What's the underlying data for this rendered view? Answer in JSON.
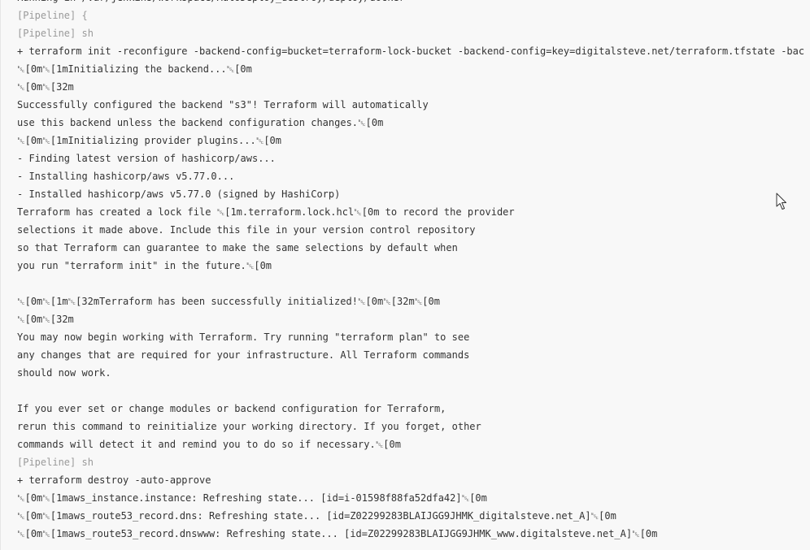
{
  "console": {
    "lines": [
      {
        "text": "Running in /var/jenkins/workspace/AutoDeploy_destroy/deploy/docker",
        "kind": "normal"
      },
      {
        "text": "[Pipeline] {",
        "kind": "pipeline"
      },
      {
        "text": "[Pipeline] sh",
        "kind": "pipeline"
      },
      {
        "text": "+ terraform init -reconfigure -backend-config=bucket=terraform-lock-bucket -backend-config=key=digitalsteve.net/terraform.tfstate -bac",
        "kind": "normal"
      },
      {
        "text": "\u001b[0m\u001b[1mInitializing the backend...\u001b[0m",
        "kind": "normal"
      },
      {
        "text": "\u001b[0m\u001b[32m",
        "kind": "normal"
      },
      {
        "text": "Successfully configured the backend \"s3\"! Terraform will automatically",
        "kind": "normal"
      },
      {
        "text": "use this backend unless the backend configuration changes.\u001b[0m",
        "kind": "normal"
      },
      {
        "text": "\u001b[0m\u001b[1mInitializing provider plugins...\u001b[0m",
        "kind": "normal"
      },
      {
        "text": "- Finding latest version of hashicorp/aws...",
        "kind": "normal"
      },
      {
        "text": "- Installing hashicorp/aws v5.77.0...",
        "kind": "normal"
      },
      {
        "text": "- Installed hashicorp/aws v5.77.0 (signed by HashiCorp)",
        "kind": "normal"
      },
      {
        "text": "Terraform has created a lock file \u001b[1m.terraform.lock.hcl\u001b[0m to record the provider",
        "kind": "normal"
      },
      {
        "text": "selections it made above. Include this file in your version control repository",
        "kind": "normal"
      },
      {
        "text": "so that Terraform can guarantee to make the same selections by default when",
        "kind": "normal"
      },
      {
        "text": "you run \"terraform init\" in the future.\u001b[0m",
        "kind": "normal"
      },
      {
        "text": "",
        "kind": "blank"
      },
      {
        "text": "\u001b[0m\u001b[1m\u001b[32mTerraform has been successfully initialized!\u001b[0m\u001b[32m\u001b[0m",
        "kind": "normal"
      },
      {
        "text": "\u001b[0m\u001b[32m",
        "kind": "normal"
      },
      {
        "text": "You may now begin working with Terraform. Try running \"terraform plan\" to see",
        "kind": "normal"
      },
      {
        "text": "any changes that are required for your infrastructure. All Terraform commands",
        "kind": "normal"
      },
      {
        "text": "should now work.",
        "kind": "normal"
      },
      {
        "text": "",
        "kind": "blank"
      },
      {
        "text": "If you ever set or change modules or backend configuration for Terraform,",
        "kind": "normal"
      },
      {
        "text": "rerun this command to reinitialize your working directory. If you forget, other",
        "kind": "normal"
      },
      {
        "text": "commands will detect it and remind you to do so if necessary.\u001b[0m",
        "kind": "normal"
      },
      {
        "text": "[Pipeline] sh",
        "kind": "pipeline"
      },
      {
        "text": "+ terraform destroy -auto-approve",
        "kind": "normal"
      },
      {
        "text": "\u001b[0m\u001b[1maws_instance.instance: Refreshing state... [id=i-01598f88fa52dfa42]\u001b[0m",
        "kind": "normal"
      },
      {
        "text": "\u001b[0m\u001b[1maws_route53_record.dns: Refreshing state... [id=Z02299283BLAIJGG9JHMK_digitalsteve.net_A]\u001b[0m",
        "kind": "normal"
      },
      {
        "text": "\u001b[0m\u001b[1maws_route53_record.dnswww: Refreshing state... [id=Z02299283BLAIJGG9JHMK_www.digitalsteve.net_A]\u001b[0m",
        "kind": "normal"
      }
    ]
  },
  "cursor": {
    "icon": "mouse-pointer-icon"
  }
}
